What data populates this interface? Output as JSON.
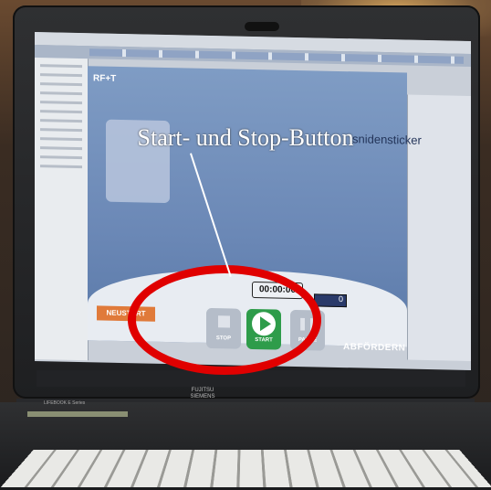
{
  "annotation": {
    "callout": "Start- und Stop-Button"
  },
  "app": {
    "brand": "RF+T",
    "company": "snidensticker",
    "timer": "00:00:00",
    "counter": "0",
    "buttons": {
      "stop": "STOP",
      "start": "START",
      "pause": "PAUSE"
    },
    "neustart": "NEUSTART",
    "abfoerdern": "ABFÖRDERN"
  },
  "laptop": {
    "brand_line1": "FUJITSU",
    "brand_line2": "SIEMENS",
    "model": "LIFEBOOK E Series"
  },
  "colors": {
    "ring": "#e00000",
    "start_button": "#2e9c4a",
    "app_background": "#6b88b6"
  }
}
